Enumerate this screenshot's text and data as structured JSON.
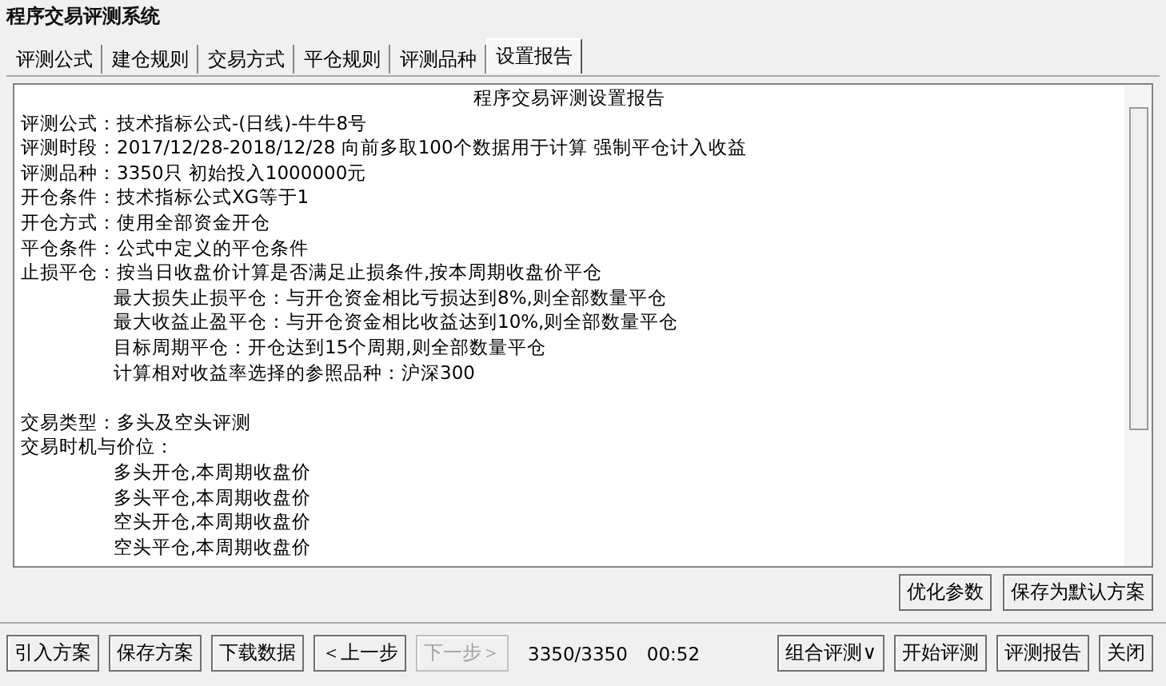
{
  "window": {
    "title": "程序交易评测系统"
  },
  "tabs": [
    {
      "label": "评测公式",
      "selected": false
    },
    {
      "label": "建仓规则",
      "selected": false
    },
    {
      "label": "交易方式",
      "selected": false
    },
    {
      "label": "平仓规则",
      "selected": false
    },
    {
      "label": "评测品种",
      "selected": false
    },
    {
      "label": "设置报告",
      "selected": true
    }
  ],
  "report": {
    "title": "程序交易评测设置报告",
    "lines": [
      {
        "kind": "field",
        "label": "评测公式：",
        "value": "技术指标公式-(日线)-牛牛8号"
      },
      {
        "kind": "field",
        "label": "评测时段：",
        "value": "2017/12/28-2018/12/28 向前多取100个数据用于计算 强制平仓计入收益"
      },
      {
        "kind": "field",
        "label": "评测品种：",
        "value": "3350只 初始投入1000000元"
      },
      {
        "kind": "field",
        "label": "开仓条件：",
        "value": "技术指标公式XG等于1"
      },
      {
        "kind": "field",
        "label": "开仓方式：",
        "value": "使用全部资金开仓"
      },
      {
        "kind": "field",
        "label": "平仓条件：",
        "value": "公式中定义的平仓条件"
      },
      {
        "kind": "field",
        "label": "止损平仓：",
        "value": "按当日收盘价计算是否满足止损条件,按本周期收盘价平仓"
      },
      {
        "kind": "indent",
        "value": "最大损失止损平仓：与开仓资金相比亏损达到8%,则全部数量平仓"
      },
      {
        "kind": "indent",
        "value": "最大收益止盈平仓：与开仓资金相比收益达到10%,则全部数量平仓"
      },
      {
        "kind": "indent",
        "value": "目标周期平仓：开仓达到15个周期,则全部数量平仓"
      },
      {
        "kind": "indent",
        "value": "计算相对收益率选择的参照品种：沪深300"
      },
      {
        "kind": "spacer"
      },
      {
        "kind": "field",
        "label": "交易类型：",
        "value": "多头及空头评测"
      },
      {
        "kind": "field",
        "label": "交易时机与价位："
      },
      {
        "kind": "indent",
        "value": "多头开仓,本周期收盘价"
      },
      {
        "kind": "indent",
        "value": "多头平仓,本周期收盘价"
      },
      {
        "kind": "indent",
        "value": "空头开仓,本周期收盘价"
      },
      {
        "kind": "indent",
        "value": "空头平仓,本周期收盘价"
      }
    ]
  },
  "report_buttons": [
    {
      "label": "优化参数",
      "disabled": false
    },
    {
      "label": "保存为默认方案",
      "disabled": false
    }
  ],
  "footer": {
    "left_buttons": [
      {
        "label": "引入方案",
        "disabled": false
      },
      {
        "label": "保存方案",
        "disabled": false
      },
      {
        "label": "下载数据",
        "disabled": false
      },
      {
        "label": "＜上一步",
        "disabled": false
      },
      {
        "label": "下一步＞",
        "disabled": true
      }
    ],
    "progress": "3350/3350",
    "elapsed": "00:52",
    "right_buttons": [
      {
        "label": "组合评测∨",
        "disabled": false
      },
      {
        "label": "开始评测",
        "disabled": false
      },
      {
        "label": "评测报告",
        "disabled": false
      },
      {
        "label": "关闭",
        "disabled": false
      }
    ]
  }
}
